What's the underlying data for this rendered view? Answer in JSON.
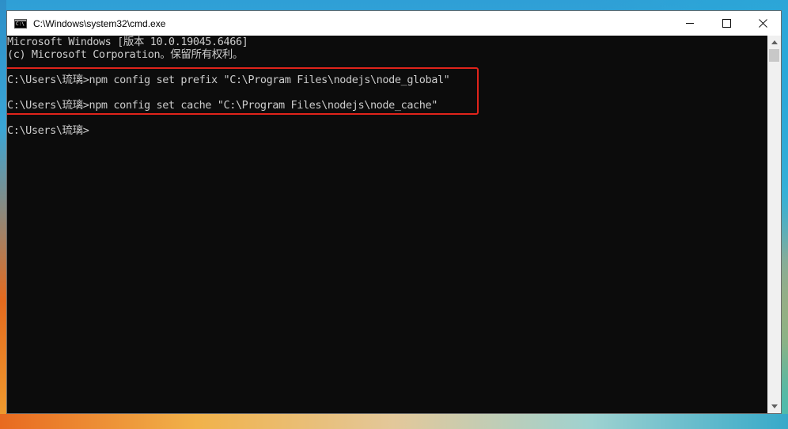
{
  "window": {
    "title": "C:\\Windows\\system32\\cmd.exe"
  },
  "console": {
    "lines": [
      "Microsoft Windows [版本 10.0.19045.6466]",
      "(c) Microsoft Corporation。保留所有权利。",
      "C:\\Users\\琉璃>npm config set prefix \"C:\\Program Files\\nodejs\\node_global\"",
      "C:\\Users\\琉璃>npm config set cache \"C:\\Program Files\\nodejs\\node_cache\"",
      "C:\\Users\\琉璃>"
    ]
  },
  "colors": {
    "console_bg": "#0c0c0c",
    "console_text": "#cccccc",
    "highlight_border": "#e0241b"
  },
  "icons": {
    "app": "cmd-icon",
    "minimize": "minimize-icon",
    "maximize": "maximize-icon",
    "close": "close-icon"
  }
}
